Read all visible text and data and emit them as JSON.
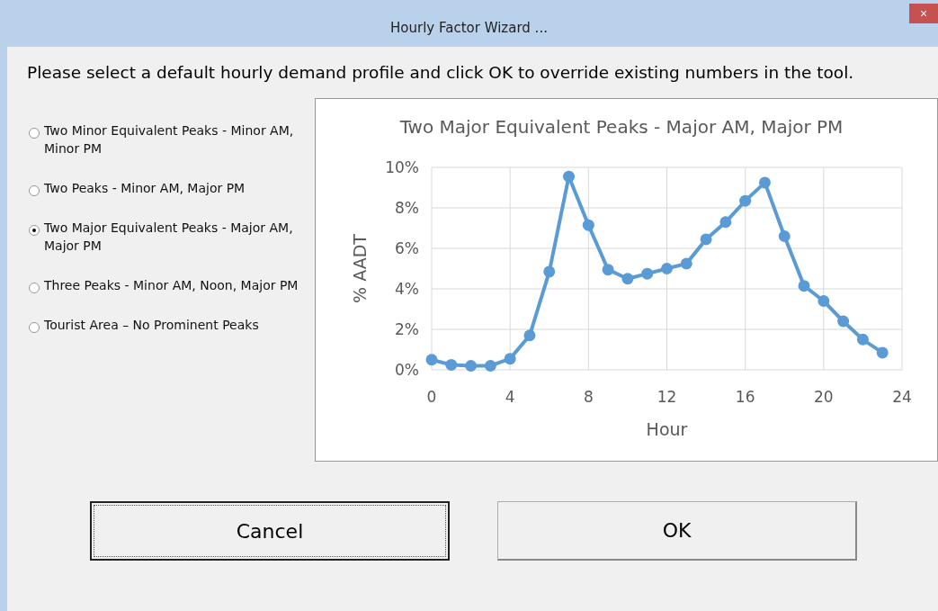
{
  "window": {
    "title": "Hourly Factor Wizard ...",
    "close": "×"
  },
  "instruction": "Please select a default hourly demand profile and click OK to override existing numbers in the tool.",
  "options": [
    {
      "label": "Two Minor Equivalent Peaks - Minor AM, Minor PM",
      "selected": false
    },
    {
      "label": "Two Peaks - Minor AM, Major PM",
      "selected": false
    },
    {
      "label": "Two Major Equivalent Peaks - Major AM, Major PM",
      "selected": true
    },
    {
      "label": "Three Peaks - Minor AM, Noon, Major PM",
      "selected": false
    },
    {
      "label": "Tourist Area – No Prominent Peaks",
      "selected": false
    }
  ],
  "chart": {
    "chart_data": {
      "type": "line",
      "title": "Two Major Equivalent Peaks - Major AM, Major PM",
      "xlabel": "Hour",
      "ylabel": "% AADT",
      "x": [
        0,
        1,
        2,
        3,
        4,
        5,
        6,
        7,
        8,
        9,
        10,
        11,
        12,
        13,
        14,
        15,
        16,
        17,
        18,
        19,
        20,
        21,
        22,
        23
      ],
      "grid": true,
      "series": [
        {
          "color": "#5b9bd5",
          "marker": true,
          "values": [
            0.5,
            0.25,
            0.2,
            0.2,
            0.55,
            1.7,
            4.85,
            9.55,
            7.15,
            4.95,
            4.5,
            4.75,
            5.0,
            5.25,
            6.45,
            7.3,
            8.35,
            9.25,
            6.6,
            4.15,
            3.4,
            2.4,
            1.5,
            0.85
          ]
        }
      ],
      "xlim": [
        0,
        24
      ],
      "ylim": [
        0,
        10
      ],
      "xticks": [
        0,
        4,
        8,
        12,
        16,
        20,
        24
      ],
      "yticks": [
        {
          "value": 0,
          "label": "0%"
        },
        {
          "value": 2,
          "label": "2%"
        },
        {
          "value": 4,
          "label": "4%"
        },
        {
          "value": 6,
          "label": "6%"
        },
        {
          "value": 8,
          "label": "8%"
        },
        {
          "value": 10,
          "label": "10%"
        }
      ]
    }
  },
  "buttons": [
    {
      "label": "Cancel",
      "focused": true
    },
    {
      "label": "OK",
      "focused": false
    }
  ]
}
